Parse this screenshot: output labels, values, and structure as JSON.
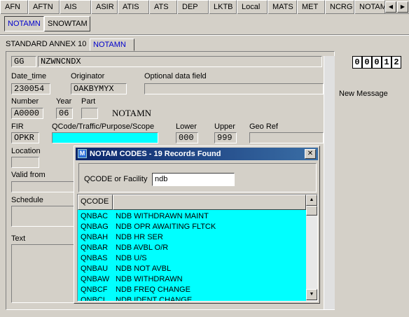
{
  "top_tabs": [
    "AFN",
    "AFTN",
    "AIS",
    "ASIR",
    "ATIS",
    "ATS",
    "DEP",
    "LKTB",
    "Local",
    "MATS",
    "MET",
    "NCRG",
    "NOTAM"
  ],
  "sub_tabs": [
    "NOTAMN",
    "SNOWTAM"
  ],
  "section_tabs": [
    "STANDARD ANNEX 10",
    "NOTAMN"
  ],
  "form": {
    "gg_label": "GG",
    "gg_value": "NZWNCNDX",
    "date_time_label": "Date_time",
    "date_time_value": "230054",
    "originator_label": "Originator",
    "originator_value": "OAKBYMYX",
    "optional_label": "Optional data field",
    "optional_value": "",
    "number_label": "Number",
    "number_value": "A0000",
    "year_label": "Year",
    "year_value": "06",
    "part_label": "Part",
    "part_value": "",
    "type_text": "NOTAMN",
    "fir_label": "FIR",
    "fir_value": "OPKR",
    "qcode_label": "QCode/Traffic/Purpose/Scope",
    "qcode_value": "",
    "lower_label": "Lower",
    "lower_value": "000",
    "upper_label": "Upper",
    "upper_value": "999",
    "georef_label": "Geo Ref",
    "georef_value": "",
    "location_label": "Location",
    "valid_from_label": "Valid from",
    "schedule_label": "Schedule",
    "text_label": "Text"
  },
  "counter": [
    "0",
    "0",
    "0",
    "1",
    "2"
  ],
  "new_message": "New Message",
  "dialog": {
    "title": "NOTAM CODES - 19 Records Found",
    "icon_letter": "M",
    "close_glyph": "✕",
    "search_label": "QCODE or Facility",
    "search_value": "ndb",
    "column_header": "QCODE",
    "rows": [
      {
        "code": "QNBAC",
        "desc": "NDB WITHDRAWN MAINT"
      },
      {
        "code": "QNBAG",
        "desc": "NDB OPR AWAITING FLTCK"
      },
      {
        "code": "QNBAH",
        "desc": "NDB HR SER"
      },
      {
        "code": "QNBAR",
        "desc": "NDB AVBL O/R"
      },
      {
        "code": "QNBAS",
        "desc": "NDB U/S"
      },
      {
        "code": "QNBAU",
        "desc": "NDB NOT AVBL"
      },
      {
        "code": "QNBAW",
        "desc": "NDB WITHDRAWN"
      },
      {
        "code": "QNBCF",
        "desc": "NDB FREQ CHANGE"
      },
      {
        "code": "QNBCI",
        "desc": "NDB IDENT CHANGE"
      }
    ]
  },
  "colors": {
    "titlebar": "#0a246a",
    "list_background": "#00ffff",
    "active_tab_text": "#0000cc"
  }
}
